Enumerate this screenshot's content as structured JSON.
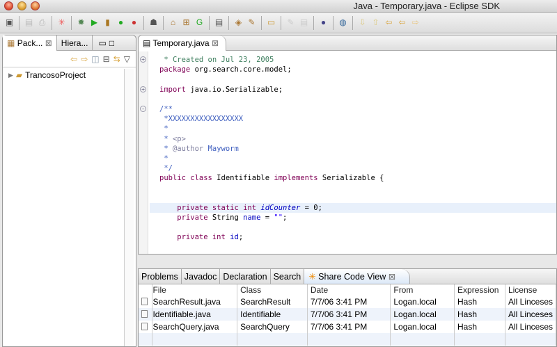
{
  "window": {
    "title": "Java - Temporary.java - Eclipse SDK"
  },
  "left_panel": {
    "tabs": [
      {
        "label": "Pack..."
      },
      {
        "label": "Hiera..."
      }
    ],
    "tree": [
      {
        "label": "TrancosoProject"
      }
    ]
  },
  "editor": {
    "tab": "Temporary.java",
    "lines": [
      {
        "fold": "+",
        "tokens": [
          [
            " * Created on Jul 23, 2005",
            "cm"
          ]
        ]
      },
      {
        "tokens": [
          [
            "package",
            "kw"
          ],
          [
            " org.search.core.model;",
            "pl"
          ]
        ]
      },
      {
        "tokens": []
      },
      {
        "fold": "+",
        "tokens": [
          [
            "import",
            "kw"
          ],
          [
            " java.io.Serializable;",
            "pl"
          ]
        ]
      },
      {
        "tokens": []
      },
      {
        "fold": "-",
        "tokens": [
          [
            "/**",
            "jd"
          ]
        ]
      },
      {
        "tokens": [
          [
            " *XXXXXXXXXXXXXXXXX",
            "jd"
          ]
        ]
      },
      {
        "tokens": [
          [
            " *",
            "jd"
          ]
        ]
      },
      {
        "tokens": [
          [
            " * ",
            "jd"
          ],
          [
            "<p>",
            "jt"
          ]
        ]
      },
      {
        "tokens": [
          [
            " * ",
            "jd"
          ],
          [
            "@author",
            "jt"
          ],
          [
            " Mayworm",
            "jd"
          ]
        ]
      },
      {
        "tokens": [
          [
            " *",
            "jd"
          ]
        ]
      },
      {
        "tokens": [
          [
            " */",
            "jd"
          ]
        ]
      },
      {
        "tokens": [
          [
            "public class",
            "kw"
          ],
          [
            " Identifiable ",
            "pl"
          ],
          [
            "implements",
            "kw"
          ],
          [
            " Serializable {",
            "pl"
          ]
        ]
      },
      {
        "tokens": []
      },
      {
        "tokens": []
      },
      {
        "highlight": true,
        "tokens": [
          [
            "    private static int",
            "kw"
          ],
          [
            " ",
            "pl"
          ],
          [
            "idCounter",
            "sfld"
          ],
          [
            " = 0;",
            "pl"
          ]
        ]
      },
      {
        "tokens": [
          [
            "    private",
            "kw"
          ],
          [
            " String ",
            "pl"
          ],
          [
            "name",
            "fld"
          ],
          [
            " = ",
            "pl"
          ],
          [
            "\"\"",
            "str"
          ],
          [
            ";",
            "pl"
          ]
        ]
      },
      {
        "tokens": []
      },
      {
        "tokens": [
          [
            "    private int",
            "kw"
          ],
          [
            " ",
            "pl"
          ],
          [
            "id",
            "fld"
          ],
          [
            ";",
            "pl"
          ]
        ]
      }
    ]
  },
  "bottom_panel": {
    "tabs": [
      "Problems",
      "Javadoc",
      "Declaration",
      "Search",
      "Share Code View"
    ],
    "columns": [
      "File",
      "Class",
      "Date",
      "From",
      "Expression",
      "License"
    ],
    "rows": [
      [
        "SearchResult.java",
        "SearchResult",
        "7/7/06 3:41 PM",
        "Logan.local",
        "Hash",
        "All Linceses"
      ],
      [
        "Identifiable.java",
        "Identifiable",
        "7/7/06 3:41 PM",
        "Logan.local",
        "Hash",
        "All Linceses"
      ],
      [
        "SearchQuery.java",
        "SearchQuery",
        "7/7/06 3:41 PM",
        "Logan.local",
        "Hash",
        "All Linceses"
      ]
    ]
  }
}
